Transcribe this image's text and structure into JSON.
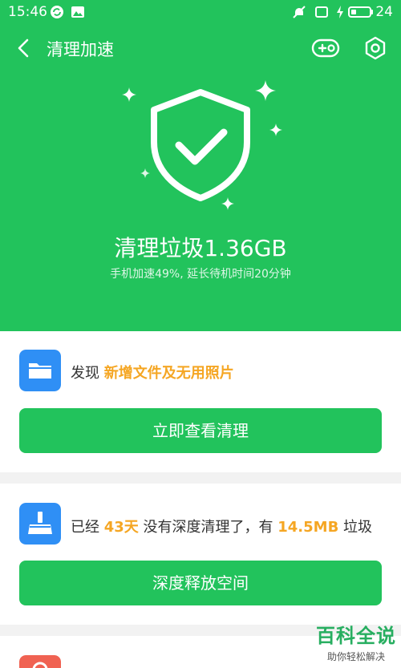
{
  "status_bar": {
    "time": "15:46",
    "battery_level": "24"
  },
  "app_bar": {
    "title": "清理加速"
  },
  "hero": {
    "title": "清理垃圾1.36GB",
    "subtitle": "手机加速49%, 延长待机时间20分钟"
  },
  "card_new_files": {
    "prefix": "发现 ",
    "highlight": "新增文件及无用照片",
    "button_label": "立即查看清理"
  },
  "card_deep_clean": {
    "part1": "已经 ",
    "days": "43天",
    "part2": " 没有深度清理了，有 ",
    "size": "14.5MB",
    "part3": " 垃圾",
    "button_label": "深度释放空间"
  },
  "watermark": {
    "title": "百科全说",
    "subtitle": "助你轻松解决"
  },
  "colors": {
    "accent": "#22c35c",
    "highlight": "#f5a623",
    "folder_icon": "#2f8ff5",
    "card3_icon": "#f06252"
  }
}
